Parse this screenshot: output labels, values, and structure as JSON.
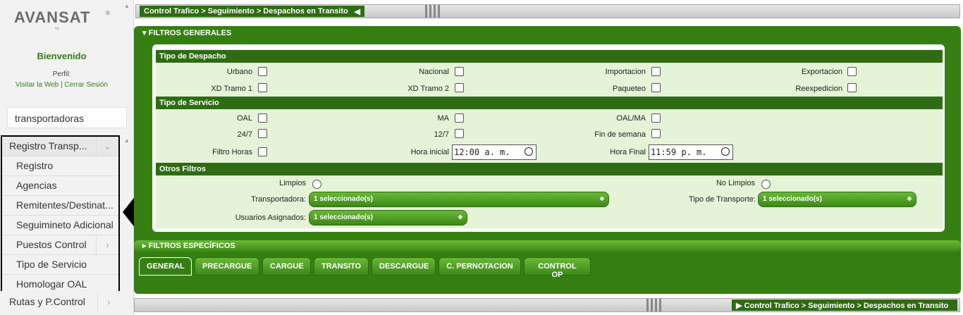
{
  "logo": {
    "text": "AVANSAT",
    "sub": "GL"
  },
  "welcome": "Bienvenido",
  "perfil": "Perfil:",
  "links": {
    "web": "Visitar la Web",
    "sep": "|",
    "logout": "Cerrar Sesión"
  },
  "search": {
    "value": "transportadoras"
  },
  "menu": {
    "head": "Registro Transp...",
    "items": [
      "Registro",
      "Agencias",
      "Remitentes/Destinat...",
      "Seguimineto Adicional",
      "Puestos Control",
      "Tipo de Servicio",
      "Homologar OAL"
    ],
    "rutas": "Rutas y P.Control"
  },
  "breadcrumb": "Control Trafico > Seguimiento > Despachos en Transito",
  "filtros_generales": "FILTROS GENERALES",
  "tipo_despacho": {
    "title": "Tipo de Despacho",
    "opts": [
      "Urbano",
      "Nacional",
      "Importacion",
      "Exportacion",
      "XD Tramo 1",
      "XD Tramo 2",
      "Paqueteo",
      "Reexpedicion"
    ]
  },
  "tipo_servicio": {
    "title": "Tipo de Servicio",
    "opts": [
      "OAL",
      "MA",
      "OAL/MA",
      "24/7",
      "12/7",
      "Fin de semana"
    ],
    "filtro_horas": "Filtro Horas",
    "hora_inicial": "Hora inicial",
    "hora_inicial_val": "12:00 a. m.",
    "hora_final": "Hora Final",
    "hora_final_val": "11:59 p. m."
  },
  "otros": {
    "title": "Otros Filtros",
    "limpios": "Limpios",
    "no_limpios": "No Limpios",
    "transportadora": "Transportadora:",
    "transportadora_val": "1 seleccionado(s)",
    "tipo_transporte": "Tipo de Transporte:",
    "tipo_transporte_val": "1 seleccionado(s)",
    "usuarios": "Usuarios Asignados:",
    "usuarios_val": "1 seleccionado(s)"
  },
  "filtros_especificos": "FILTROS ESPECÍFICOS",
  "tabs": [
    "GENERAL",
    "PRECARGUE",
    "CARGUE",
    "TRANSITO",
    "DESCARGUE",
    "C. PERNOTACION",
    "CONTROL OP"
  ]
}
